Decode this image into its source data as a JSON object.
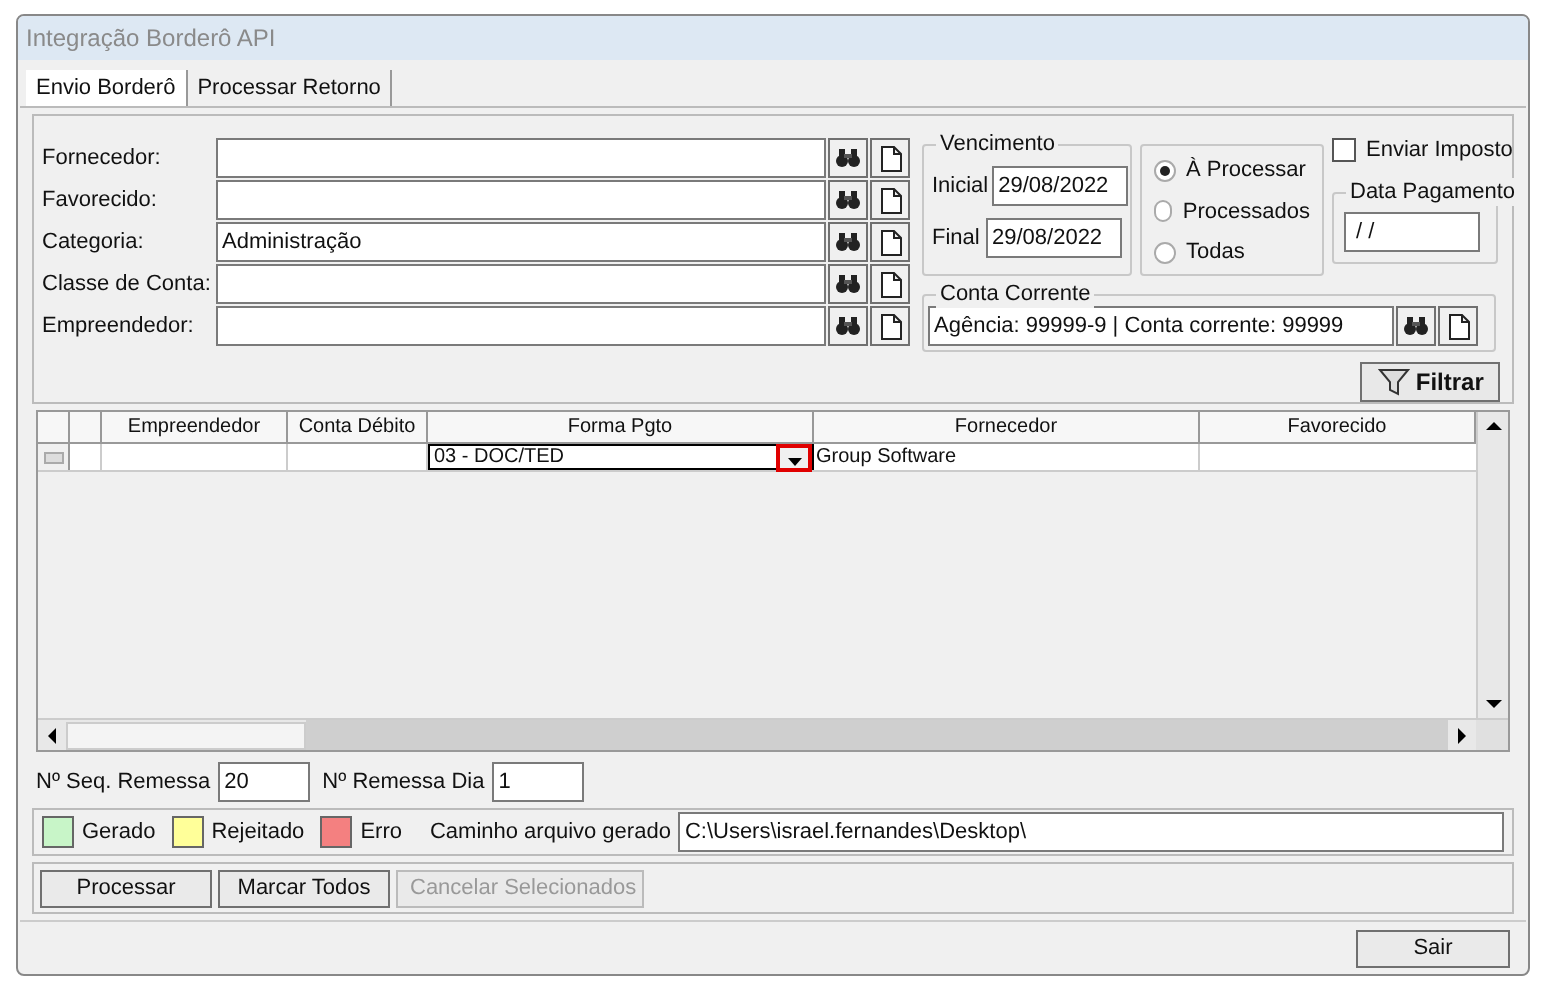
{
  "window": {
    "title": "Integração Borderô API"
  },
  "tabs": [
    {
      "label": "Envio Borderô",
      "selected": true
    },
    {
      "label": "Processar Retorno",
      "selected": false
    }
  ],
  "filters": [
    {
      "label": "Fornecedor:"
    },
    {
      "label": "Favorecido:"
    },
    {
      "label": "Categoria:",
      "value": "Administração"
    },
    {
      "label": "Classe de Conta:"
    },
    {
      "label": "Empreendedor:"
    }
  ],
  "vencimento": {
    "legend": "Vencimento",
    "inicial_label": "Inicial",
    "inicial": "29/08/2022",
    "final_label": "Final",
    "final": "29/08/2022"
  },
  "status_options": [
    {
      "label": "À Processar",
      "selected": true
    },
    {
      "label": "Processados",
      "selected": false
    },
    {
      "label": "Todas",
      "selected": false
    }
  ],
  "enviar_imposto": {
    "label": "Enviar Imposto",
    "checked": false
  },
  "data_pagamento": {
    "legend": "Data Pagamento",
    "value": " / /"
  },
  "conta_corrente": {
    "legend": "Conta Corrente",
    "value": "Agência: 99999-9 | Conta corrente: 99999"
  },
  "filter_button": "Filtrar",
  "grid": {
    "columns": [
      "Empreendedor",
      "Conta Débito",
      "Forma Pgto",
      "Fornecedor",
      "Favorecido"
    ],
    "rows": [
      {
        "forma_pgto": "03 - DOC/TED",
        "fornecedor": "Group Software"
      }
    ]
  },
  "seq_remessa": {
    "label": "Nº Seq. Remessa",
    "value": "20"
  },
  "remessa_dia": {
    "label": "Nº Remessa Dia",
    "value": "1"
  },
  "legend": [
    {
      "label": "Gerado",
      "color": "#c8f5c8"
    },
    {
      "label": "Rejeitado",
      "color": "#ffff99"
    },
    {
      "label": "Erro",
      "color": "#f48080"
    }
  ],
  "path": {
    "label": "Caminho arquivo gerado",
    "value": "C:\\Users\\israel.fernandes\\Desktop\\"
  },
  "buttons": [
    {
      "label": "Processar",
      "disabled": false
    },
    {
      "label": "Marcar Todos",
      "disabled": false
    },
    {
      "label": "Cancelar Selecionados",
      "disabled": true
    }
  ],
  "exit_button": "Sair"
}
